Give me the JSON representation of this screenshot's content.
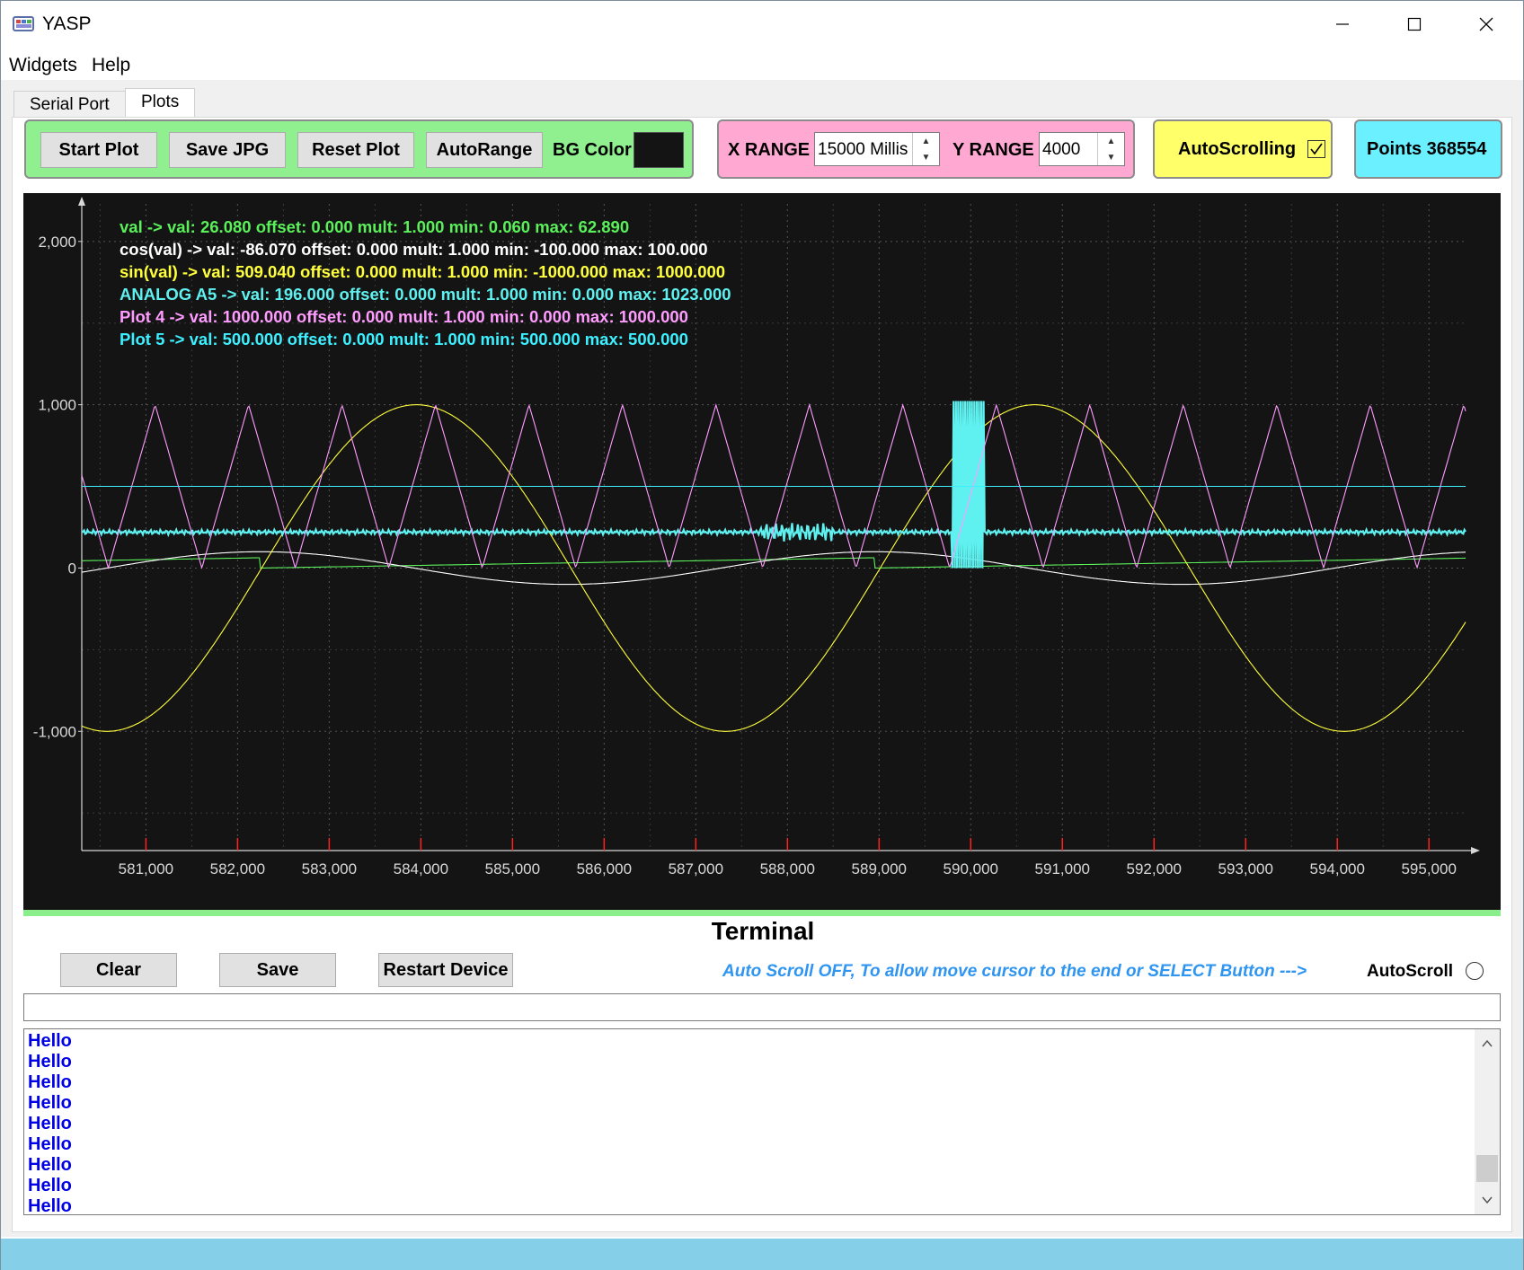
{
  "window": {
    "title": "YASP"
  },
  "menu": [
    "Widgets",
    "Help"
  ],
  "tabs": [
    {
      "label": "Serial Port"
    },
    {
      "label": "Plots"
    }
  ],
  "plot_controls": {
    "start_plot": "Start Plot",
    "save_jpg": "Save JPG",
    "reset_plot": "Reset Plot",
    "autorange": "AutoRange",
    "bg_color_label": "BG Color",
    "bg_color_value": "#141414"
  },
  "range_controls": {
    "x_label": "X RANGE",
    "x_value": "15000 Millis",
    "y_label": "Y RANGE",
    "y_value": "4000"
  },
  "autoscrolling": {
    "label": "AutoScrolling",
    "checked": true
  },
  "points": {
    "label": "Points 368554"
  },
  "chart_data": {
    "type": "line",
    "xlim": [
      580300,
      595400
    ],
    "ylim": [
      -1730,
      2230
    ],
    "x_ticks": [
      581000,
      582000,
      583000,
      584000,
      585000,
      586000,
      587000,
      588000,
      589000,
      590000,
      591000,
      592000,
      593000,
      594000,
      595000
    ],
    "x_tick_labels": [
      "581,000",
      "582,000",
      "583,000",
      "584,000",
      "585,000",
      "586,000",
      "587,000",
      "588,000",
      "589,000",
      "590,000",
      "591,000",
      "592,000",
      "593,000",
      "594,000",
      "595,000"
    ],
    "y_ticks": [
      2000,
      1000,
      0,
      -1000
    ],
    "y_tick_labels": [
      "2,000",
      "1,000",
      "0",
      "-1,000"
    ],
    "grid": true,
    "legend": [
      {
        "text": "val ->  val: 26.080 offset: 0.000 mult: 1.000 min: 0.060 max: 62.890",
        "color": "#5af05a"
      },
      {
        "text": "cos(val) ->  val: -86.070 offset: 0.000 mult: 1.000 min: -100.000 max: 100.000",
        "color": "#ffffff"
      },
      {
        "text": "sin(val) ->  val: 509.040 offset: 0.000 mult: 1.000 min: -1000.000 max: 1000.000",
        "color": "#ffff3c"
      },
      {
        "text": "ANALOG A5 ->  val: 196.000 offset: 0.000 mult: 1.000 min: 0.000 max: 1023.000",
        "color": "#5ff0f0"
      },
      {
        "text": "Plot 4 ->  val: 1000.000 offset: 0.000 mult: 1.000 min: 0.000 max: 1000.000",
        "color": "#ff9cff"
      },
      {
        "text": "Plot 5 ->  val: 500.000 offset: 0.000 mult: 1.000 min: 500.000 max: 500.000",
        "color": "#3cf0ff"
      }
    ],
    "series": [
      {
        "name": "val",
        "color": "#5af05a",
        "kind": "sawtooth",
        "x_start": 580300,
        "x_end": 595400,
        "period": 6700,
        "phase_x": 582250,
        "low": 0,
        "high": 63
      },
      {
        "name": "cos(val)",
        "color": "#ffffff",
        "kind": "sine",
        "x_start": 580300,
        "x_end": 595400,
        "period": 6700,
        "center": 0,
        "amplitude": 100,
        "peak_x": 582250
      },
      {
        "name": "sin(val)",
        "color": "#ffff3c",
        "kind": "sine",
        "x_start": 580300,
        "x_end": 595400,
        "period": 6750,
        "center": 0,
        "amplitude": 1000,
        "peak_x": 583950
      },
      {
        "name": "ANALOG A5",
        "color": "#5ff0f0",
        "kind": "noise",
        "x_start": 580300,
        "x_end": 595400,
        "center": 220,
        "amplitude": 15,
        "burst_x": [
          587700,
          588500
        ],
        "burst_amp": 60,
        "gap_x": [
          589800,
          590150
        ],
        "gap_low": 0,
        "gap_high": 1023
      },
      {
        "name": "Plot 4",
        "color": "#ff9cff",
        "kind": "triangle",
        "x_start": 580300,
        "x_end": 595400,
        "period": 1020,
        "peak_x": 581100,
        "low": 0,
        "high": 1000
      },
      {
        "name": "Plot 5",
        "color": "#3cf0ff",
        "kind": "constant",
        "x_start": 580300,
        "x_end": 595400,
        "value": 500
      }
    ]
  },
  "terminal": {
    "title": "Terminal",
    "clear": "Clear",
    "save": "Save",
    "restart": "Restart Device",
    "hint": "Auto Scroll OFF, To allow move cursor to the end or SELECT Button --->",
    "autoscroll_label": "AutoScroll",
    "autoscroll_checked": false,
    "input_value": "",
    "log": [
      "Hello",
      "Hello",
      "Hello",
      "Hello",
      "Hello",
      "Hello",
      "Hello",
      "Hello",
      "Hello"
    ]
  },
  "colors": {
    "group_green": "#90f090",
    "group_pink": "#ffa9d2",
    "group_yellow": "#ffff6a",
    "group_cyan": "#6af0ff",
    "status_bar": "#86cfe8"
  }
}
